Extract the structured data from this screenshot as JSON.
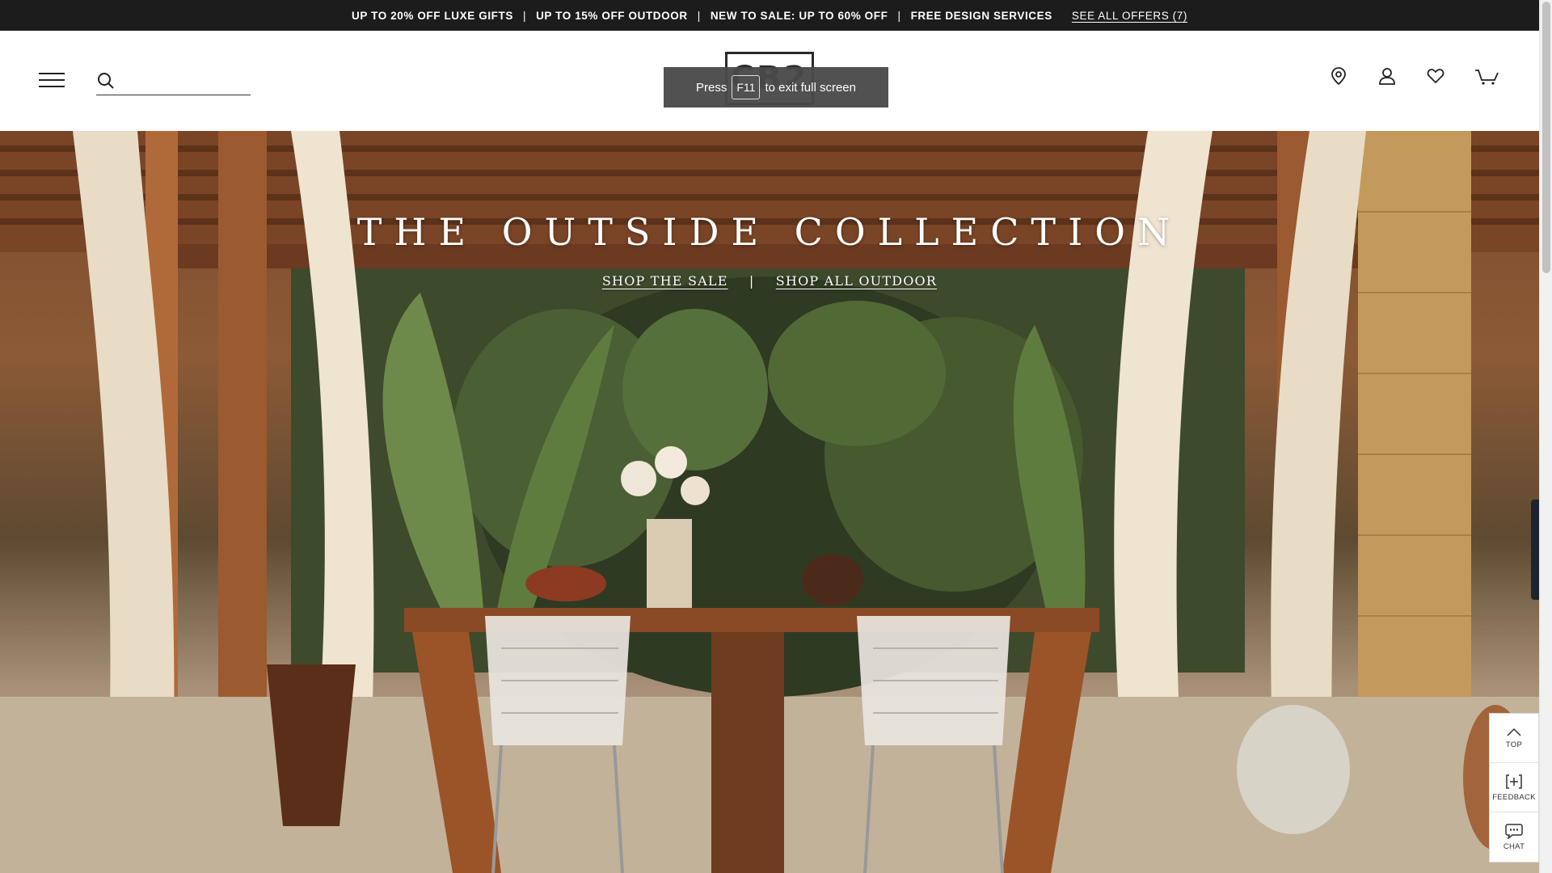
{
  "promo": {
    "items": [
      "UP TO 20% OFF LUXE GIFTS",
      "UP TO 15% OFF OUTDOOR",
      "NEW TO SALE: UP TO 60% OFF",
      "FREE DESIGN SERVICES"
    ],
    "separator": "|",
    "see_all": "SEE ALL OFFERS (7)"
  },
  "header": {
    "logo": "CB2",
    "search_placeholder": "",
    "icons": [
      "store-locator-icon",
      "account-icon",
      "favorites-icon",
      "cart-icon"
    ]
  },
  "fullscreen_toast": {
    "prefix": "Press",
    "key": "F11",
    "suffix": "to exit full screen"
  },
  "hero": {
    "title": "THE OUTSIDE COLLECTION",
    "links": [
      "SHOP THE SALE",
      "SHOP ALL OUTDOOR"
    ],
    "divider": "|"
  },
  "side_widgets": [
    {
      "label": "TOP",
      "icon": "chevron-up-icon"
    },
    {
      "label": "FEEDBACK",
      "icon": "feedback-icon"
    },
    {
      "label": "CHAT",
      "icon": "chat-icon"
    }
  ],
  "colors": {
    "promo_bg": "#1c1c1c",
    "text_dark": "#2a2a2a",
    "hero_text": "#ffffff"
  }
}
